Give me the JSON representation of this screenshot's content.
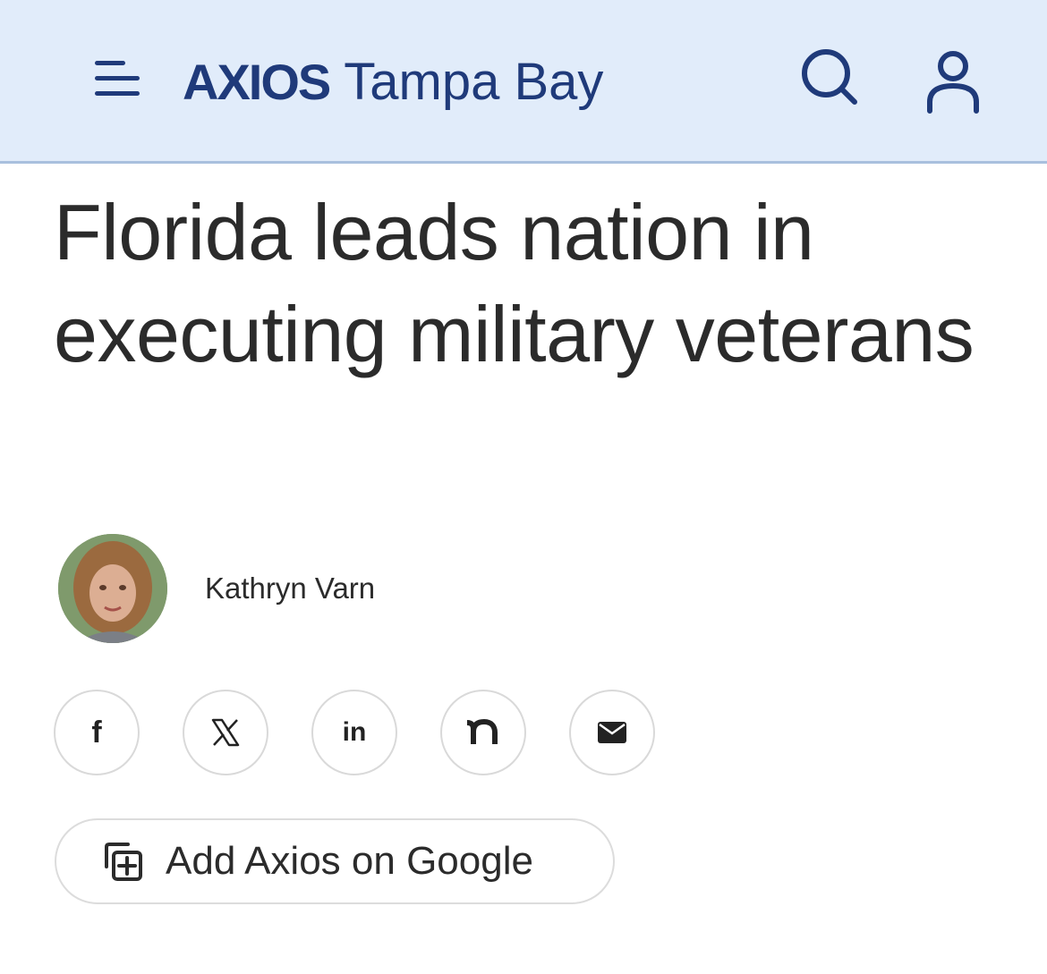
{
  "header": {
    "menu_icon": "hamburger-menu-icon",
    "brand_logo": "AXIOS",
    "brand_region": "Tampa Bay",
    "search_icon": "search-icon",
    "account_icon": "user-icon",
    "accent_color": "#1f3a7a",
    "background_color": "#e1ecfa"
  },
  "article": {
    "headline": "Florida leads nation in executing military veterans",
    "author": "Kathryn Varn"
  },
  "share": {
    "buttons": [
      {
        "icon": "facebook-icon",
        "glyph": "f"
      },
      {
        "icon": "x-icon",
        "glyph": "𝕏"
      },
      {
        "icon": "linkedin-icon",
        "glyph": "in"
      },
      {
        "icon": "nextdoor-icon",
        "glyph": "n"
      },
      {
        "icon": "email-icon",
        "glyph": ""
      }
    ]
  },
  "google_button": {
    "label": "Add Axios on Google",
    "icon": "add-to-google-icon"
  }
}
